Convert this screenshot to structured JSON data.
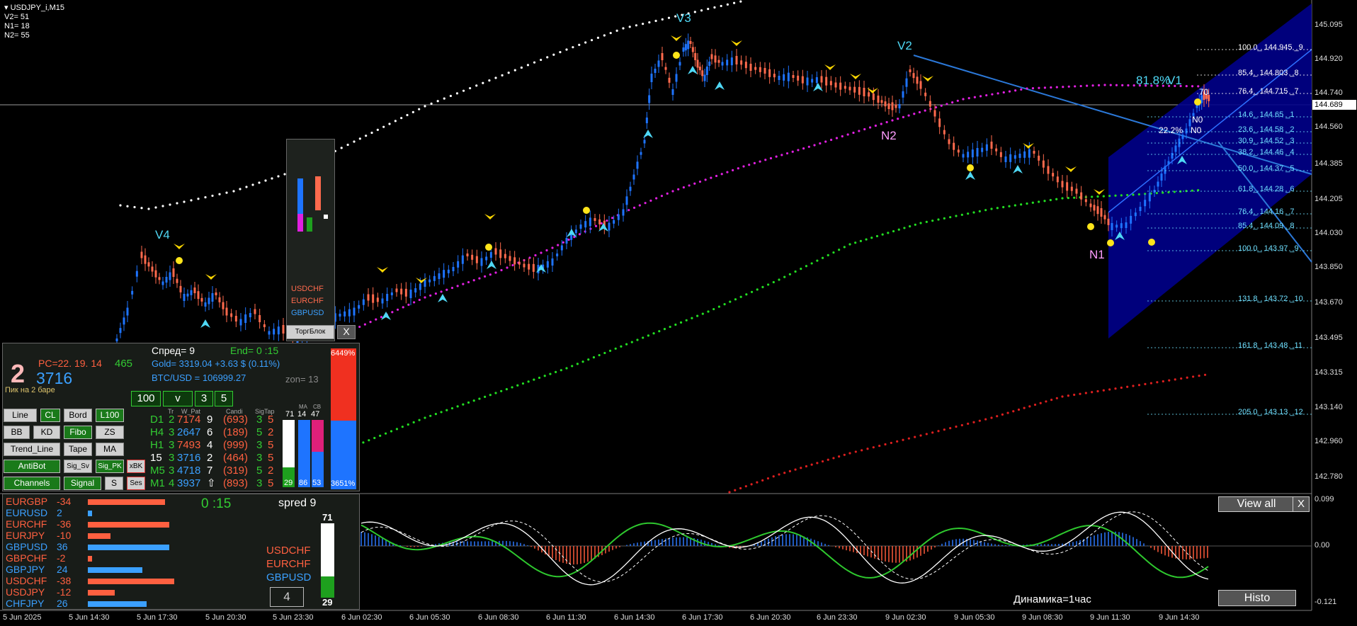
{
  "symbol": {
    "title": "USDJPY_i,M15",
    "v2": "V2= 51",
    "n1": "N1= 18",
    "n2": "N2= 55"
  },
  "current_price": "144.689",
  "price_axis": [
    "145.095",
    "144.920",
    "144.740",
    "144.560",
    "144.385",
    "144.205",
    "144.030",
    "143.850",
    "143.670",
    "143.495",
    "143.315",
    "143.140",
    "142.960",
    "142.780"
  ],
  "indicator_axis": [
    "0.099",
    "0.00",
    "-0.121"
  ],
  "time_axis": [
    "5 Jun 2025",
    "5 Jun 14:30",
    "5 Jun 17:30",
    "5 Jun 20:30",
    "5 Jun 23:30",
    "6 Jun 02:30",
    "6 Jun 05:30",
    "6 Jun 08:30",
    "6 Jun 11:30",
    "6 Jun 14:30",
    "6 Jun 17:30",
    "6 Jun 20:30",
    "6 Jun 23:30",
    "9 Jun 02:30",
    "9 Jun 05:30",
    "9 Jun 08:30",
    "9 Jun 11:30",
    "9 Jun 14:30"
  ],
  "fib_levels": [
    {
      "label": "100.0_ 144.945 _9",
      "color": "#ffffff"
    },
    {
      "label": "85.4_ 144.803 _8",
      "color": "#ffffff"
    },
    {
      "label": "76.4_ 144.715 _7",
      "color": "#ffffff"
    },
    {
      "label": "14.6_ 144.65 _1",
      "color": "#6fe0ff"
    },
    {
      "label": "23.6_ 144.58 _2",
      "color": "#6fe0ff"
    },
    {
      "label": "30.9_ 144.52 _3",
      "color": "#6fe0ff"
    },
    {
      "label": "38.2_ 144.46 _4",
      "color": "#6fe0ff"
    },
    {
      "label": "50.0_ 144.37 _5",
      "color": "#6fe0ff"
    },
    {
      "label": "61.8_ 144.28 _6",
      "color": "#6fe0ff"
    },
    {
      "label": "76.4_ 144.16 _7",
      "color": "#6fe0ff"
    },
    {
      "label": "85.4_ 144.09 _8",
      "color": "#6fe0ff"
    },
    {
      "label": "100.0_ 143.97 _9",
      "color": "#6fe0ff"
    },
    {
      "label": "131.8_ 143.72 _10",
      "color": "#6fe0ff"
    },
    {
      "label": "161.8_ 143.48 _11",
      "color": "#6fe0ff"
    },
    {
      "label": "205.0_ 143.13 _12",
      "color": "#6fe0ff"
    }
  ],
  "wave_labels": {
    "v1": "V1",
    "v2": "V2",
    "v3": "V3",
    "v4": "V4",
    "n1": "N1",
    "n2": "N2",
    "n0a": "N0",
    "n0b": "N0",
    "pct818": "81.8%",
    "pct222": "22.2%",
    "seven0": "70"
  },
  "strength_box": {
    "items": [
      "USDCHF",
      "EURCHF",
      "GBPUSD"
    ],
    "button": "ТоргБлок",
    "close": "X"
  },
  "info": {
    "big_num": "2",
    "pc": "PC=22. 19. 14",
    "pc_val": "465",
    "price": "3716",
    "peak": "Пик на 2 баре",
    "spread": "Спред= 9",
    "end": "End= 0 :15",
    "gold": "Gold= 3319.04 +3.63 $ (0.11%)",
    "btc": "BTC/USD = 106999.27",
    "zon": "zon= 13",
    "boxes": [
      "100",
      "v",
      "3",
      "5"
    ],
    "pct_top": "64",
    "pct_top2": "49%",
    "pct_bot": "36",
    "pct_bot2": "51%"
  },
  "buttons": {
    "line": "Line",
    "cl": "CL",
    "bord": "Bord",
    "l100": "L100",
    "bb": "BB",
    "kd": "KD",
    "fibo": "Fibo",
    "zs": "ZS",
    "trend": "Trend_Line",
    "tape": "Tape",
    "ma": "MA",
    "antibot": "AntiBot",
    "sigsv": "Sig_Sv",
    "sigpk": "Sig_PK",
    "xbk": "xBK",
    "channels": "Channels",
    "signal": "Signal",
    "s": "S",
    "ses": "Ses"
  },
  "table_headers": {
    "tr": "Tr",
    "wpat": "W_Pat",
    "candi": "Candi",
    "sigtap": "SigTap",
    "ma": "MA",
    "cb": "CB"
  },
  "timeframes": [
    {
      "tf": "D1",
      "a": "2",
      "b": "7174",
      "c": "9",
      "d": "(693)",
      "e": "3",
      "f": "5",
      "tfc": "#3c3",
      "bc": "#ff6040"
    },
    {
      "tf": "H4",
      "a": "3",
      "b": "2647",
      "c": "6",
      "d": "(189)",
      "e": "5",
      "f": "2",
      "tfc": "#3c3",
      "bc": "#3ba0ff"
    },
    {
      "tf": "H1",
      "a": "3",
      "b": "7493",
      "c": "4",
      "d": "(999)",
      "e": "3",
      "f": "5",
      "tfc": "#3c3",
      "bc": "#ff6040"
    },
    {
      "tf": "15",
      "a": "3",
      "b": "3716",
      "c": "2",
      "d": "(464)",
      "e": "3",
      "f": "5",
      "tfc": "#fff",
      "bc": "#3ba0ff"
    },
    {
      "tf": "M5",
      "a": "3",
      "b": "4718",
      "c": "7",
      "d": "(319)",
      "e": "5",
      "f": "2",
      "tfc": "#3c3",
      "bc": "#3ba0ff"
    },
    {
      "tf": "M1",
      "a": "4",
      "b": "3937",
      "c": "⇧",
      "d": "(893)",
      "e": "3",
      "f": "5",
      "tfc": "#3c3",
      "bc": "#3ba0ff"
    }
  ],
  "table_bars": {
    "v71": "71",
    "v29": "29",
    "ma": "14",
    "cb": "47",
    "ma_b": "86",
    "cb_b": "53"
  },
  "currency_strength": [
    {
      "sym": "EURGBP",
      "val": "-34",
      "level": -34
    },
    {
      "sym": "EURUSD",
      "val": "2",
      "level": 2
    },
    {
      "sym": "EURCHF",
      "val": "-36",
      "level": -36
    },
    {
      "sym": "EURJPY",
      "val": "-10",
      "level": -10
    },
    {
      "sym": "GBPUSD",
      "val": "36",
      "level": 36
    },
    {
      "sym": "GBPCHF",
      "val": "-2",
      "level": -2
    },
    {
      "sym": "GBPJPY",
      "val": "24",
      "level": 24
    },
    {
      "sym": "USDCHF",
      "val": "-38",
      "level": -38
    },
    {
      "sym": "USDJPY",
      "val": "-12",
      "level": -12
    },
    {
      "sym": "CHFJPY",
      "val": "26",
      "level": 26
    }
  ],
  "bottom_panel": {
    "timer": "0 :15",
    "spred": "spred 9",
    "v71": "71",
    "v29": "29",
    "num": "4",
    "items": [
      "USDCHF",
      "EURCHF",
      "GBPUSD"
    ]
  },
  "indicator": {
    "view_all": "View all",
    "close": "X",
    "histo": "Histo",
    "caption": "Динамика=1час"
  },
  "colors": {
    "bull": "#ff6a4d",
    "bear": "#1e74ff",
    "accent_cyan": "#4fd8f5",
    "fib_blue": "#000099"
  }
}
